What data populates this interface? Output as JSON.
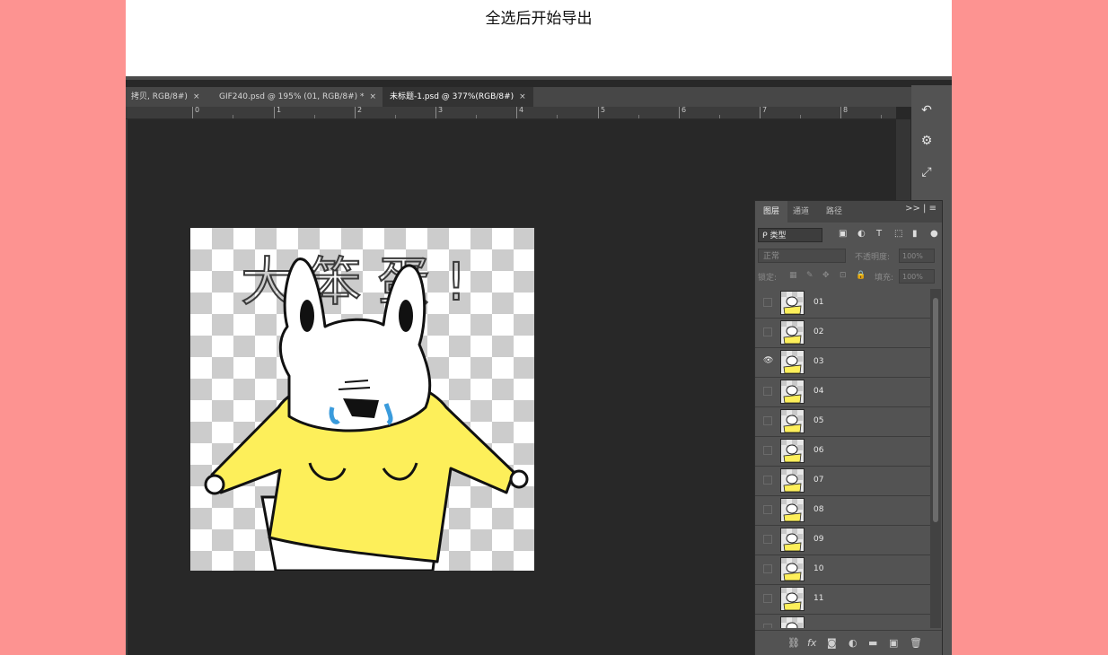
{
  "caption": "全选后开始导出",
  "document_tabs": [
    {
      "label": "拷贝, RGB/8#)",
      "close": "×",
      "active": false
    },
    {
      "label": "GIF240.psd @ 195% (01, RGB/8#) *",
      "close": "×",
      "active": false
    },
    {
      "label": "未标题-1.psd @ 377%(RGB/8#)",
      "close": "×",
      "active": true
    }
  ],
  "ruler_labels": [
    "0",
    "1",
    "2",
    "3",
    "4",
    "5",
    "6",
    "7",
    "8"
  ],
  "canvas_text": "大笨蛋!",
  "side_tools": [
    {
      "icon": "history-icon",
      "glyph": "↶"
    },
    {
      "icon": "properties-icon",
      "glyph": "⚙"
    },
    {
      "icon": "transform-icon",
      "glyph": "⤢"
    }
  ],
  "layers_panel": {
    "tabs": [
      "图层",
      "通道",
      "路径"
    ],
    "active_tab": "图层",
    "menu_glyph": ">> | ≡",
    "filter_label": "ᑭ 类型",
    "filter_icons": [
      "▣",
      "◐",
      "T",
      "⬚",
      "▮",
      "●"
    ],
    "blend_mode": "正常",
    "opacity_label": "不透明度:",
    "opacity_value": "100%",
    "lock_label": "锁定:",
    "lock_icons": [
      "▦",
      "✎",
      "✥",
      "⊡",
      "🔒"
    ],
    "fill_label": "填充:",
    "fill_value": "100%",
    "layers": [
      {
        "name": "01",
        "visible": false
      },
      {
        "name": "02",
        "visible": false
      },
      {
        "name": "03",
        "visible": true
      },
      {
        "name": "04",
        "visible": false
      },
      {
        "name": "05",
        "visible": false
      },
      {
        "name": "06",
        "visible": false
      },
      {
        "name": "07",
        "visible": false
      },
      {
        "name": "08",
        "visible": false
      },
      {
        "name": "09",
        "visible": false
      },
      {
        "name": "10",
        "visible": false
      },
      {
        "name": "11",
        "visible": false
      },
      {
        "name": "",
        "visible": false
      }
    ],
    "bottom_icons": [
      "⛓",
      "fx",
      "◙",
      "◐",
      "▬",
      "▣",
      "🗑"
    ]
  },
  "colors": {
    "page_bg": "#fd9391",
    "workspace": "#282828",
    "panel": "#535353",
    "shirt": "#fdef5a"
  }
}
